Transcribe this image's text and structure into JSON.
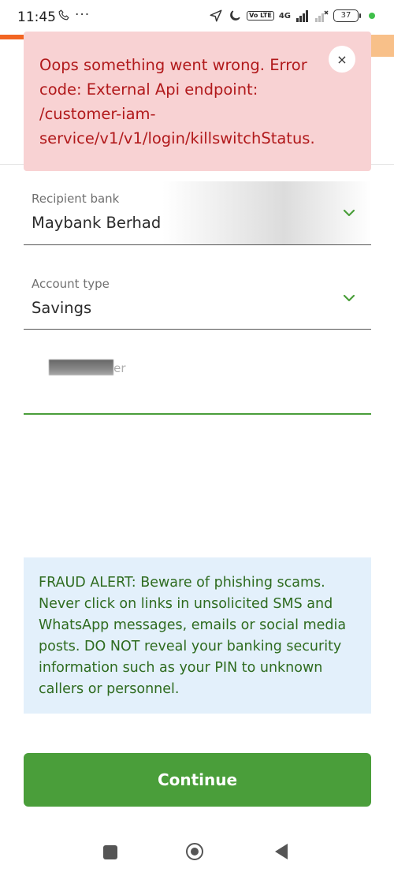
{
  "status_bar": {
    "time": "11:45",
    "network": "4G",
    "volte": "Vo LTE",
    "battery": "37",
    "icons": [
      "phone-icon",
      "more-dots-icon",
      "location-arrow-icon",
      "moon-icon",
      "signal-icon",
      "wifi-off-icon",
      "battery-icon"
    ]
  },
  "toast": {
    "message": "Oops something went wrong. Error code: External Api endpoint: /customer-iam-service/v1/v1/login/killswitchStatus.",
    "close_label": "×"
  },
  "form": {
    "recipient_bank": {
      "label": "Recipient bank",
      "value": "Maybank Berhad"
    },
    "account_type": {
      "label": "Account type",
      "value": "Savings"
    },
    "account_number": {
      "label_fragment": "mber"
    }
  },
  "fraud_alert": {
    "text": "FRAUD ALERT: Beware of phishing scams. Never click on links in unsolicited SMS and WhatsApp messages, emails or social media posts. DO NOT reveal your banking security information such as your PIN to unknown callers or personnel."
  },
  "continue_button": {
    "label": "Continue"
  },
  "colors": {
    "accent_green": "#4a9e3a",
    "error_bg": "#f8d2d3",
    "error_text": "#b1191b",
    "fraud_bg": "#e3f0fb",
    "fraud_text": "#2e6b1f",
    "brand_orange": "#f26522"
  },
  "nav_bar": {
    "icons": [
      "recent-apps-icon",
      "home-icon",
      "back-icon"
    ]
  }
}
